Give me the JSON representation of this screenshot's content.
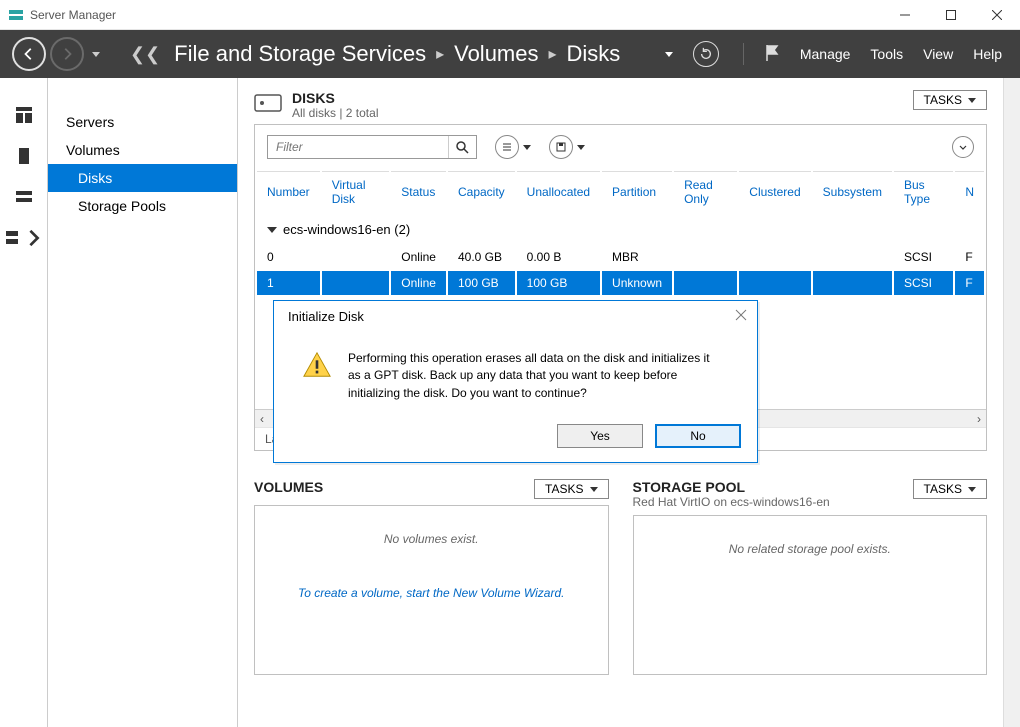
{
  "titlebar": {
    "app_name": "Server Manager"
  },
  "nav": {
    "crumb1": "File and Storage Services",
    "crumb2": "Volumes",
    "crumb3": "Disks",
    "menu_manage": "Manage",
    "menu_tools": "Tools",
    "menu_view": "View",
    "menu_help": "Help"
  },
  "sidebar": {
    "items": [
      {
        "label": "Servers"
      },
      {
        "label": "Volumes"
      },
      {
        "label": "Disks"
      },
      {
        "label": "Storage Pools"
      }
    ]
  },
  "disks_section": {
    "title": "DISKS",
    "subtitle": "All disks | 2 total",
    "tasks_label": "TASKS",
    "filter_placeholder": "Filter",
    "columns": {
      "c0": "Number",
      "c1": "Virtual Disk",
      "c2": "Status",
      "c3": "Capacity",
      "c4": "Unallocated",
      "c5": "Partition",
      "c6": "Read Only",
      "c7": "Clustered",
      "c8": "Subsystem",
      "c9": "Bus Type",
      "c10": "N"
    },
    "group_label": "ecs-windows16-en (2)",
    "rows": [
      {
        "number": "0",
        "virtual_disk": "",
        "status": "Online",
        "capacity": "40.0 GB",
        "unallocated": "0.00 B",
        "partition": "MBR",
        "read_only": "",
        "clustered": "",
        "subsystem": "",
        "bus_type": "SCSI",
        "n": "F"
      },
      {
        "number": "1",
        "virtual_disk": "",
        "status": "Online",
        "capacity": "100 GB",
        "unallocated": "100 GB",
        "partition": "Unknown",
        "read_only": "",
        "clustered": "",
        "subsystem": "",
        "bus_type": "SCSI",
        "n": "F"
      }
    ],
    "footer": "Last r"
  },
  "volumes_card": {
    "title": "VOLUMES",
    "tasks_label": "TASKS",
    "empty_text": "No volumes exist.",
    "link_text": "To create a volume, start the New Volume Wizard."
  },
  "storage_card": {
    "title": "STORAGE POOL",
    "subtitle": "Red Hat VirtIO on ecs-windows16-en",
    "tasks_label": "TASKS",
    "empty_text": "No related storage pool exists."
  },
  "dialog": {
    "title": "Initialize Disk",
    "message": "Performing this operation erases all data on the disk and initializes it as a GPT disk. Back up any data that you want to keep before initializing the disk. Do you want to continue?",
    "yes": "Yes",
    "no": "No"
  }
}
